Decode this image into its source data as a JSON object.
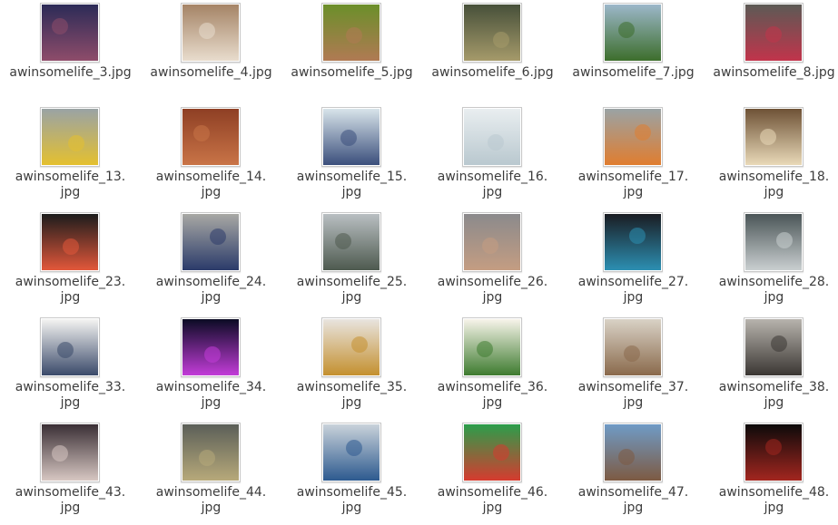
{
  "files": [
    {
      "name": "awinsomelife_3.jpg",
      "lines": [
        "awinsomelife_3.jpg"
      ],
      "icon": "image-quote-purple-thumbnail",
      "colors": [
        "#2c2b57",
        "#8e4c6a"
      ]
    },
    {
      "name": "awinsomelife_4.jpg",
      "lines": [
        "awinsomelife_4.jpg"
      ],
      "icon": "image-drinks-thumbnail",
      "colors": [
        "#a58466",
        "#e8dccd"
      ]
    },
    {
      "name": "awinsomelife_5.jpg",
      "lines": [
        "awinsomelife_5.jpg"
      ],
      "icon": "image-person-green-thumbnail",
      "colors": [
        "#6b8f2a",
        "#b07a53"
      ]
    },
    {
      "name": "awinsomelife_6.jpg",
      "lines": [
        "awinsomelife_6.jpg"
      ],
      "icon": "image-quote-forest-thumbnail",
      "colors": [
        "#47503a",
        "#a59a6a"
      ]
    },
    {
      "name": "awinsomelife_7.jpg",
      "lines": [
        "awinsomelife_7.jpg"
      ],
      "icon": "image-buildings-thumbnail",
      "colors": [
        "#9cb7c9",
        "#3d6e2c"
      ]
    },
    {
      "name": "awinsomelife_8.jpg",
      "lines": [
        "awinsomelife_8.jpg"
      ],
      "icon": "image-luggage-thumbnail",
      "colors": [
        "#5c5a55",
        "#c1344b"
      ]
    },
    {
      "name": "awinsomelife_13.jpg",
      "lines": [
        "awinsomelife_13.",
        "jpg"
      ],
      "icon": "image-map-route-thumbnail",
      "colors": [
        "#9aa3a5",
        "#e4c02f"
      ]
    },
    {
      "name": "awinsomelife_14.jpg",
      "lines": [
        "awinsomelife_14.",
        "jpg"
      ],
      "icon": "image-crab-food-thumbnail",
      "colors": [
        "#8e3f24",
        "#c97447"
      ]
    },
    {
      "name": "awinsomelife_15.jpg",
      "lines": [
        "awinsomelife_15.",
        "jpg"
      ],
      "icon": "image-group-photo-thumbnail",
      "colors": [
        "#d8e4ea",
        "#3b4f7c"
      ]
    },
    {
      "name": "awinsomelife_16.jpg",
      "lines": [
        "awinsomelife_16.",
        "jpg"
      ],
      "icon": "image-quote-clouds-thumbnail",
      "colors": [
        "#e9eef0",
        "#b9c8cf"
      ]
    },
    {
      "name": "awinsomelife_17.jpg",
      "lines": [
        "awinsomelife_17.",
        "jpg"
      ],
      "icon": "image-map-route-orange-thumbnail",
      "colors": [
        "#9aa3a5",
        "#e07d2f"
      ]
    },
    {
      "name": "awinsomelife_18.jpg",
      "lines": [
        "awinsomelife_18.",
        "jpg"
      ],
      "icon": "image-food-table-thumbnail",
      "colors": [
        "#6e5236",
        "#e9d9b8"
      ]
    },
    {
      "name": "awinsomelife_23.jpg",
      "lines": [
        "awinsomelife_23.",
        "jpg"
      ],
      "icon": "image-salad-bowl-thumbnail",
      "colors": [
        "#1c1c1c",
        "#e2573a"
      ]
    },
    {
      "name": "awinsomelife_24.jpg",
      "lines": [
        "awinsomelife_24.",
        "jpg"
      ],
      "icon": "image-bicycles-thumbnail",
      "colors": [
        "#a8a8a4",
        "#2b3b6a"
      ]
    },
    {
      "name": "awinsomelife_25.jpg",
      "lines": [
        "awinsomelife_25.",
        "jpg"
      ],
      "icon": "image-station-thumbnail",
      "colors": [
        "#b9bfc2",
        "#4e5a4f"
      ]
    },
    {
      "name": "awinsomelife_26.jpg",
      "lines": [
        "awinsomelife_26.",
        "jpg"
      ],
      "icon": "image-selfie-thumbnail",
      "colors": [
        "#8b8a8c",
        "#c49d82"
      ]
    },
    {
      "name": "awinsomelife_27.jpg",
      "lines": [
        "awinsomelife_27.",
        "jpg"
      ],
      "icon": "image-pool-night-thumbnail",
      "colors": [
        "#1a1c22",
        "#2c8fb2"
      ]
    },
    {
      "name": "awinsomelife_28.jpg",
      "lines": [
        "awinsomelife_28.",
        "jpg"
      ],
      "icon": "image-quote-mountain-thumbnail",
      "colors": [
        "#4b5557",
        "#c9cfd0"
      ]
    },
    {
      "name": "awinsomelife_33.jpg",
      "lines": [
        "awinsomelife_33.",
        "jpg"
      ],
      "icon": "image-infographic-thumbnail",
      "colors": [
        "#f4f4f2",
        "#3a4a6a"
      ]
    },
    {
      "name": "awinsomelife_34.jpg",
      "lines": [
        "awinsomelife_34.",
        "jpg"
      ],
      "icon": "image-light-tower-thumbnail",
      "colors": [
        "#0b0b24",
        "#c23cd8"
      ]
    },
    {
      "name": "awinsomelife_35.jpg",
      "lines": [
        "awinsomelife_35.",
        "jpg"
      ],
      "icon": "image-toast-drinks-thumbnail",
      "colors": [
        "#e8e4df",
        "#c4902f"
      ]
    },
    {
      "name": "awinsomelife_36.jpg",
      "lines": [
        "awinsomelife_36.",
        "jpg"
      ],
      "icon": "image-quote-leaves-thumbnail",
      "colors": [
        "#f7f4ea",
        "#3e7b2f"
      ]
    },
    {
      "name": "awinsomelife_37.jpg",
      "lines": [
        "awinsomelife_37.",
        "jpg"
      ],
      "icon": "image-cafe-thumbnail",
      "colors": [
        "#d9d2c6",
        "#8a6a4c"
      ]
    },
    {
      "name": "awinsomelife_38.jpg",
      "lines": [
        "awinsomelife_38.",
        "jpg"
      ],
      "icon": "image-grill-thumbnail",
      "colors": [
        "#b7b3ad",
        "#3b3733"
      ]
    },
    {
      "name": "awinsomelife_43.jpg",
      "lines": [
        "awinsomelife_43.",
        "jpg"
      ],
      "icon": "image-hotel-room-thumbnail",
      "colors": [
        "#3a2f35",
        "#d7c7c2"
      ]
    },
    {
      "name": "awinsomelife_44.jpg",
      "lines": [
        "awinsomelife_44.",
        "jpg"
      ],
      "icon": "image-quote-volcano-thumbnail",
      "colors": [
        "#5b5f58",
        "#b7a97a"
      ]
    },
    {
      "name": "awinsomelife_45.jpg",
      "lines": [
        "awinsomelife_45.",
        "jpg"
      ],
      "icon": "image-shopping-cart-thumbnail",
      "colors": [
        "#c9d2da",
        "#2d5a8f"
      ]
    },
    {
      "name": "awinsomelife_46.jpg",
      "lines": [
        "awinsomelife_46.",
        "jpg"
      ],
      "icon": "image-green-stage-thumbnail",
      "colors": [
        "#2b9e4b",
        "#d63b2f"
      ]
    },
    {
      "name": "awinsomelife_47.jpg",
      "lines": [
        "awinsomelife_47.",
        "jpg"
      ],
      "icon": "image-beach-selfie-thumbnail",
      "colors": [
        "#6f9bc6",
        "#7d5a42"
      ]
    },
    {
      "name": "awinsomelife_48.jpg",
      "lines": [
        "awinsomelife_48.",
        "jpg"
      ],
      "icon": "image-dark-night-thumbnail",
      "colors": [
        "#0c0a0a",
        "#a3261f"
      ]
    }
  ]
}
